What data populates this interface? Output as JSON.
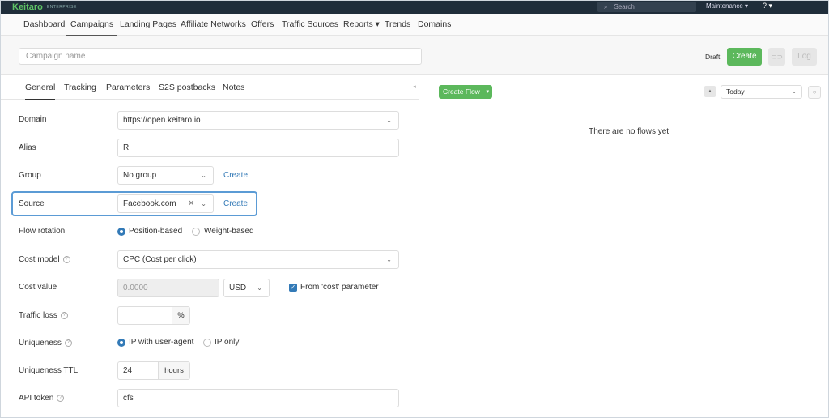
{
  "topbar": {
    "brand": "Keitaro",
    "brand_sub": "ENTERPRISE",
    "search_placeholder": "Search",
    "maintenance": "Maintenance ▾",
    "help": "? ▾"
  },
  "nav": {
    "items": [
      "Dashboard",
      "Campaigns",
      "Landing Pages",
      "Affiliate Networks",
      "Offers",
      "Traffic Sources",
      "Reports ▾",
      "Trends",
      "Domains"
    ]
  },
  "campaign": {
    "name_placeholder": "Campaign name",
    "status": "Draft",
    "create_label": "Create",
    "link_icon_text": "⊂⊃",
    "log_label": "Log"
  },
  "tabs": [
    "General",
    "Tracking",
    "Parameters",
    "S2S postbacks",
    "Notes"
  ],
  "form": {
    "domain_label": "Domain",
    "domain_value": "https://open.keitaro.io",
    "alias_label": "Alias",
    "alias_value": "R",
    "group_label": "Group",
    "group_value": "No group",
    "group_create": "Create",
    "source_label": "Source",
    "source_value": "Facebook.com",
    "source_create": "Create",
    "flow_rotation_label": "Flow rotation",
    "flow_rotation_options": [
      "Position-based",
      "Weight-based"
    ],
    "cost_model_label": "Cost model",
    "cost_model_value": "CPC (Cost per click)",
    "cost_value_label": "Cost value",
    "cost_value_value": "0.0000",
    "currency_value": "USD",
    "from_cost_label": "From 'cost' parameter",
    "traffic_loss_label": "Traffic loss",
    "traffic_loss_unit": "%",
    "uniqueness_label": "Uniqueness",
    "uniqueness_options": [
      "IP with user-agent",
      "IP only"
    ],
    "uniqueness_ttl_label": "Uniqueness TTL",
    "uniqueness_ttl_value": "24",
    "uniqueness_ttl_unit": "hours",
    "api_token_label": "API token",
    "api_token_value": "cfs"
  },
  "flows": {
    "create_flow_label": "Create Flow",
    "date_value": "Today",
    "empty_text": "There are no flows yet."
  },
  "colors": {
    "accent_green": "#5cb85c",
    "link_blue": "#337ab7",
    "topbar": "#1f2d3a",
    "highlight": "#5b9bd5"
  }
}
